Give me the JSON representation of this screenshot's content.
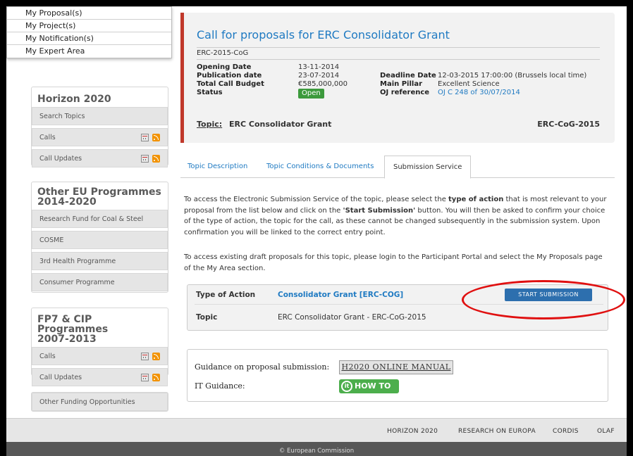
{
  "user_menu": {
    "items": [
      "My Proposal(s)",
      "My Project(s)",
      "My Notification(s)",
      "My Expert Area"
    ]
  },
  "sidebar": {
    "horizon": {
      "title": "Horizon 2020",
      "items": [
        {
          "label": "Search Topics"
        },
        {
          "label": "Calls"
        },
        {
          "label": "Call Updates"
        }
      ]
    },
    "other_eu": {
      "title_line1": "Other EU Programmes",
      "title_line2": "2014-2020",
      "items": [
        {
          "label": "Research Fund for Coal & Steel"
        },
        {
          "label": "COSME"
        },
        {
          "label": "3rd Health Programme"
        },
        {
          "label": "Consumer Programme"
        }
      ]
    },
    "fp7": {
      "title_line1": "FP7 & CIP Programmes",
      "title_line2": "2007-2013",
      "items": [
        {
          "label": "Calls"
        },
        {
          "label": "Call Updates"
        }
      ]
    },
    "other_funding": {
      "label": "Other Funding Opportunities"
    }
  },
  "call": {
    "title": "Call for proposals for ERC Consolidator Grant",
    "id": "ERC-2015-CoG",
    "opening_label": "Opening Date",
    "opening_value": "13-11-2014",
    "publication_label": "Publication date",
    "publication_value": "23-07-2014",
    "budget_label": "Total Call Budget",
    "budget_value": "€585,000,000",
    "status_label": "Status",
    "status_value": "Open",
    "deadline_label": "Deadline Date",
    "deadline_value": "12-03-2015 17:00:00 (Brussels local time)",
    "pillar_label": "Main Pillar",
    "pillar_value": "Excellent Science",
    "oj_label": "OJ reference",
    "oj_value": "OJ C 248 of 30/07/2014",
    "topic_label": "Topic:",
    "topic_name": "ERC Consolidator Grant",
    "topic_code": "ERC-CoG-2015"
  },
  "tabs": {
    "description": "Topic Description",
    "conditions": "Topic Conditions & Documents",
    "submission": "Submission Service"
  },
  "content": {
    "para1_a": "To access the Electronic Submission Service of the topic, please select the ",
    "para1_b": "type of action",
    "para1_c": " that is most relevant to your proposal from the list below and click on the ",
    "para1_d": "'Start Submission'",
    "para1_e": " button. You will then be asked to confirm your choice of the type of action, the topic for the call, as these cannot be changed subsequently in the submission system. Upon confirmation you will be linked to the correct entry point.",
    "para2": "To access existing draft proposals for this topic, please login to the Participant Portal and select the My Proposals page of the My Area section."
  },
  "action": {
    "type_label": "Type of Action",
    "type_value": "Consolidator Grant [ERC-COG]",
    "start_button": "START SUBMISSION",
    "topic_label": "Topic",
    "topic_value": "ERC Consolidator Grant - ERC-CoG-2015"
  },
  "guidance": {
    "label1": "Guidance on proposal submission:",
    "manual_button": "H2020 ONLINE MANUAL",
    "label2": "IT Guidance:",
    "howto_icon": "it",
    "howto_button": "HOW TO"
  },
  "footer": {
    "links": [
      "HORIZON 2020",
      "RESEARCH ON EUROPA",
      "CORDIS",
      "OLAF"
    ],
    "copyright": "© European Commission"
  },
  "colors": {
    "link_blue": "#1f7ac2",
    "accent_red": "#c0392b",
    "status_green": "#3c9a3c",
    "button_blue": "#2d6fae",
    "highlight_ellipse": "#e01010"
  }
}
